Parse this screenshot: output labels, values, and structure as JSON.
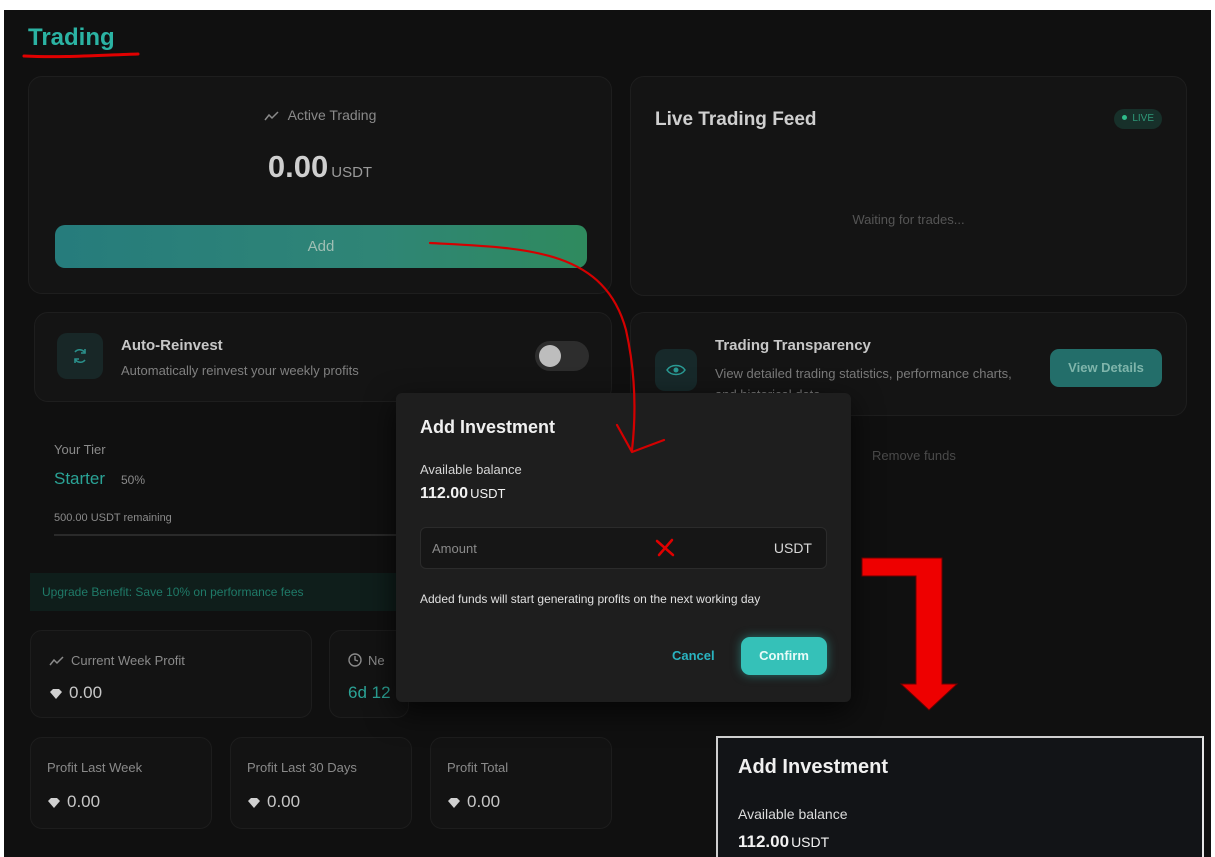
{
  "page": {
    "title": "Trading"
  },
  "active_trading": {
    "label": "Active Trading",
    "value": "0.00",
    "unit": "USDT",
    "add_label": "Add"
  },
  "live_feed": {
    "title": "Live Trading Feed",
    "badge": "LIVE",
    "waiting": "Waiting for trades..."
  },
  "auto_reinvest": {
    "title": "Auto-Reinvest",
    "subtitle": "Automatically reinvest your weekly profits",
    "enabled": false
  },
  "transparency": {
    "title": "Trading Transparency",
    "subtitle": "View detailed trading statistics, performance charts, and historical data.",
    "button": "View Details"
  },
  "remove_funds": "Remove funds",
  "tier": {
    "label": "Your Tier",
    "name": "Starter",
    "percent": "50%",
    "remaining": "500.00 USDT remaining"
  },
  "upgrade_banner": "Upgrade Benefit: Save 10% on performance fees",
  "stats": {
    "current_week": {
      "label": "Current Week Profit",
      "value": "0.00"
    },
    "next": {
      "label": "Ne",
      "value": "6d 12"
    },
    "last_week": {
      "label": "Profit Last Week",
      "value": "0.00"
    },
    "last_30": {
      "label": "Profit Last 30 Days",
      "value": "0.00"
    },
    "total": {
      "label": "Profit Total",
      "value": "0.00"
    }
  },
  "modal": {
    "title": "Add Investment",
    "balance_label": "Available balance",
    "balance_value": "112.00",
    "balance_unit": "USDT",
    "amount_placeholder": "Amount",
    "amount_unit": "USDT",
    "note": "Added funds will start generating profits on the next working day",
    "cancel": "Cancel",
    "confirm": "Confirm"
  },
  "inset": {
    "title": "Add Investment",
    "balance_label": "Available balance",
    "balance_value": "112.00",
    "balance_unit": "USDT"
  },
  "colors": {
    "accent": "#2bb3a3",
    "annotation": "#e00000",
    "background": "#101010"
  }
}
